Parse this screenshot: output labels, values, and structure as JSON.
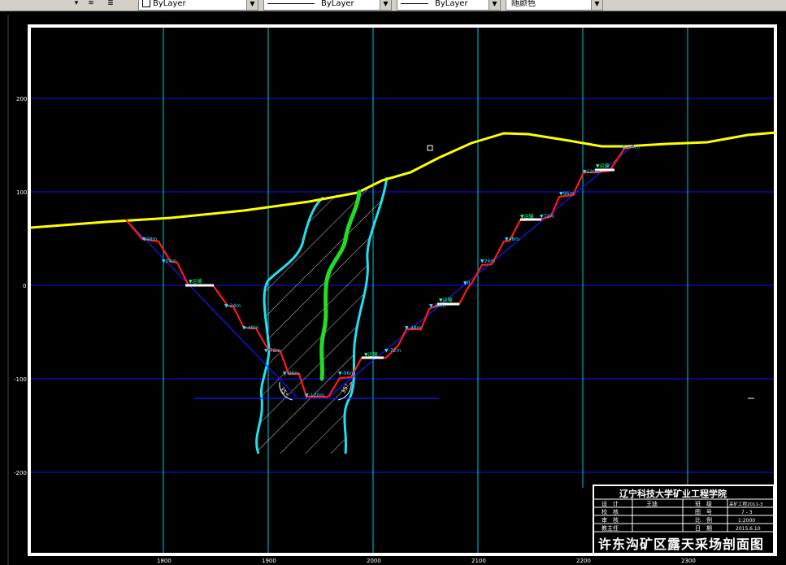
{
  "toolbar": {
    "layer_color": "ByLayer",
    "linetype": "ByLayer",
    "lineweight": "ByLayer",
    "plot_style": "随颜色"
  },
  "colors": {
    "background": "#000000",
    "grid_vertical": "#00ffff",
    "grid_horizontal": "#0000ff",
    "ground_surface": "#ffff00",
    "pit_slope": "#ff0000",
    "ore_body_boundary": "#00ffff",
    "coal_seam": "#00ff00",
    "hatch": "#ffffff",
    "frame": "#ffffff"
  },
  "axes": {
    "x_ticks": [
      "1800",
      "1900",
      "2000",
      "2100",
      "2200",
      "2300"
    ],
    "y_ticks": [
      "200",
      "100",
      "0",
      "-100",
      "-200"
    ]
  },
  "slope_labels": {
    "left": [
      "▼48m",
      "▼24m",
      "▼0",
      "▼-24m",
      "▼-48m",
      "▼-72m",
      "▼-96m",
      "▼-120m"
    ],
    "right": [
      "▼144m",
      "▼120m",
      "▼96m",
      "▼72m",
      "▼48m",
      "▼24m",
      "▼0",
      "▼-24m",
      "▼-48m",
      "▼-72m",
      "▼-96m"
    ],
    "ramp": "▼运输",
    "angle_left": "35°",
    "angle_right": "35°"
  },
  "title_block": {
    "institution": "辽宁科技大学矿业工程学院",
    "rows": [
      {
        "k1": "设　计",
        "v1": "王迪",
        "k2": "班　级",
        "v2": "采矿工程2011-3"
      },
      {
        "k1": "校　核",
        "v1": "",
        "k2": "图　号",
        "v2": "7 - 3"
      },
      {
        "k1": "审　核",
        "v1": "",
        "k2": "比　例",
        "v2": "1:2000"
      },
      {
        "k1": "教主任",
        "v1": "",
        "k2": "日　期",
        "v2": "2015.6.10"
      }
    ],
    "drawing_title": "许东沟矿区露天采场剖面图"
  }
}
